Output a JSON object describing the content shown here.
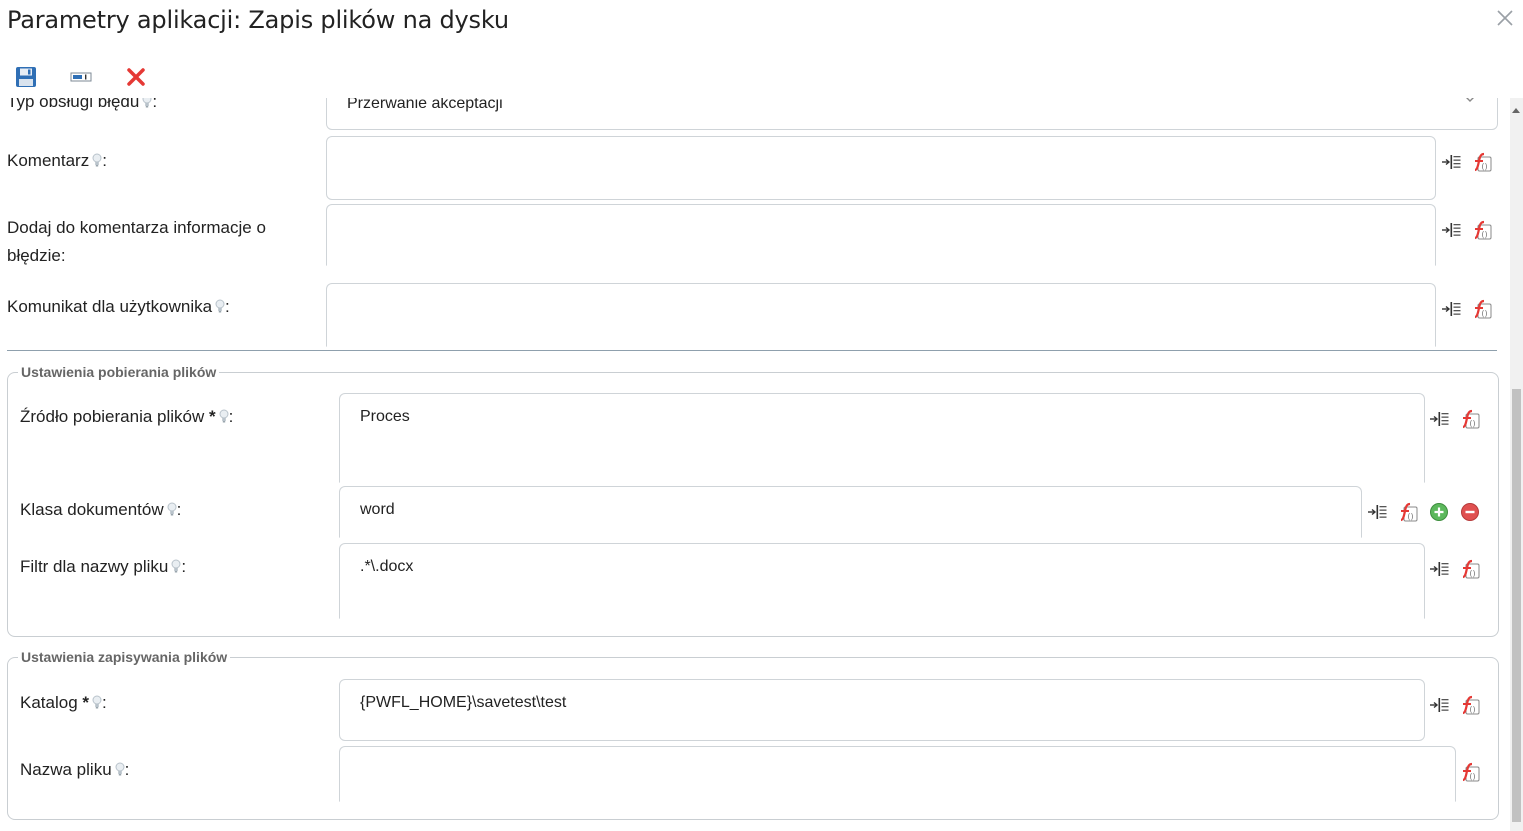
{
  "dialog": {
    "title": "Parametry aplikacji: Zapis plików na dysku"
  },
  "toolbar": {
    "save": "save",
    "apply": "apply",
    "cancel": "cancel"
  },
  "top_section": {
    "error_type_label": "Typ obsługi błędu",
    "error_type_value": "Przerwanie akceptacji",
    "comment_label": "Komentarz",
    "comment_value": "",
    "add_error_info_label": "Dodaj do komentarza informacje o błędzie:",
    "add_error_info_value": "",
    "user_message_label": "Komunikat dla użytkownika",
    "user_message_value": ""
  },
  "download_group": {
    "legend": "Ustawienia pobierania plików",
    "source_label": "Źródło pobierania plików",
    "source_value": "Proces",
    "doc_class_label": "Klasa dokumentów",
    "doc_class_value": "word",
    "filter_label": "Filtr dla nazwy pliku",
    "filter_value": ".*\\.docx"
  },
  "save_group": {
    "legend": "Ustawienia zapisywania plików",
    "catalog_label": "Katalog",
    "catalog_value": "{PWFL_HOME}\\savetest\\test",
    "filename_label": "Nazwa pliku",
    "filename_value": ""
  },
  "common": {
    "required_mark": "*",
    "colon": ":"
  },
  "colors": {
    "accent_red": "#e53935",
    "save_blue": "#2f6fb5",
    "add_green": "#5cb85c",
    "remove_red": "#e05050",
    "separator": "#8fa0ad"
  },
  "icons": {
    "hint": "lightbulb-icon",
    "insert_variable": "insert-variable-icon",
    "function": "function-icon"
  }
}
